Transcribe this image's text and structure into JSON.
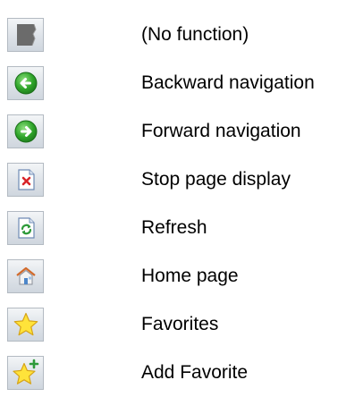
{
  "buttons": [
    {
      "icon": "blank-page-icon",
      "label": "(No function)"
    },
    {
      "icon": "back-arrow-icon",
      "label": "Backward navigation"
    },
    {
      "icon": "forward-arrow-icon",
      "label": "Forward navigation"
    },
    {
      "icon": "stop-page-icon",
      "label": "Stop page display"
    },
    {
      "icon": "refresh-icon",
      "label": "Refresh"
    },
    {
      "icon": "home-icon",
      "label": "Home page"
    },
    {
      "icon": "favorites-star-icon",
      "label": "Favorites"
    },
    {
      "icon": "add-favorite-icon",
      "label": "Add Favorite"
    }
  ],
  "colors": {
    "arrow_green": "#2fa52a",
    "star_yellow": "#ffe33a",
    "stop_red": "#d8252a",
    "refresh_green": "#2e9a3a",
    "blank_page_gray": "#6b6b6b"
  }
}
